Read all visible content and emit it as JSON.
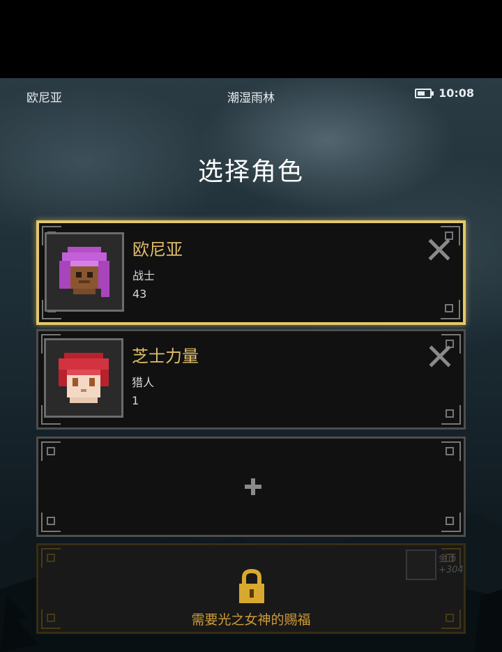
{
  "status_bar": {
    "location": "欧尼亚",
    "zone": "潮湿雨林",
    "time": "10:08"
  },
  "screen_title": "选择角色",
  "characters": [
    {
      "name": "欧尼亚",
      "class": "战士",
      "level": "43",
      "selected": true
    },
    {
      "name": "芝士力量",
      "class": "猎人",
      "level": "1",
      "selected": false
    }
  ],
  "locked_slot": {
    "message": "需要光之女神的赐福",
    "gold_label": "金币",
    "gold_value": "+304"
  },
  "colors": {
    "accent_gold": "#e5c76b",
    "name_gold": "#e0bd6b",
    "lock_gold": "#d9a43a"
  },
  "icons": {
    "delete": "close-icon",
    "add": "plus-icon",
    "lock": "lock-icon",
    "battery": "battery-icon"
  }
}
